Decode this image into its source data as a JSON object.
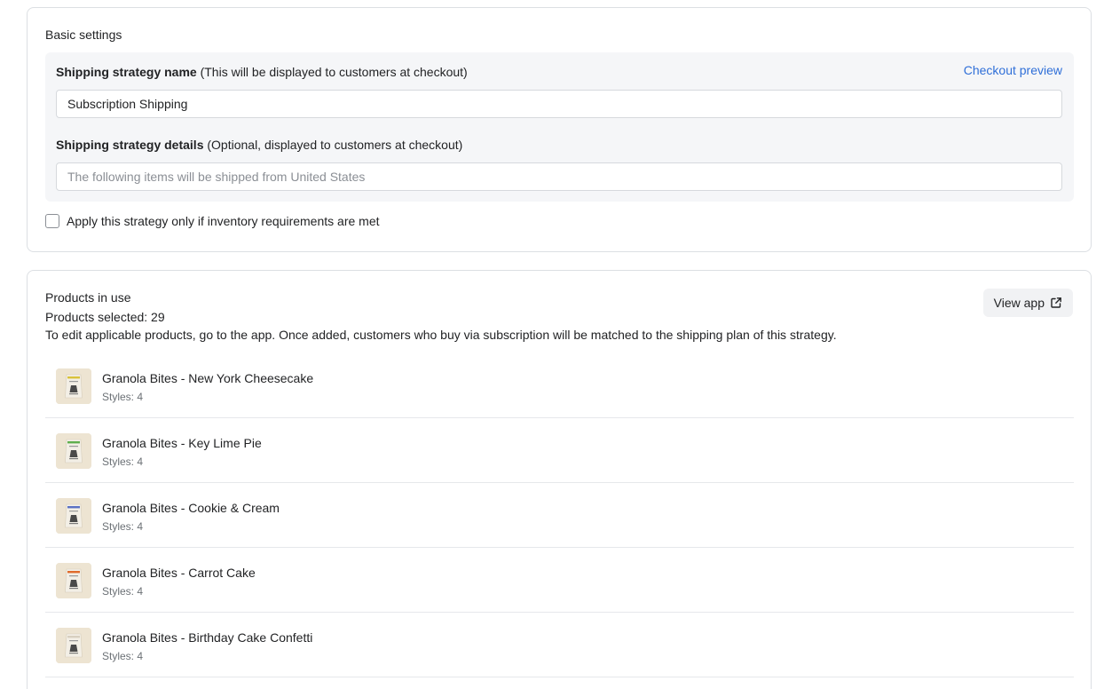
{
  "basic_settings": {
    "title": "Basic settings",
    "name_label_bold": "Shipping strategy name",
    "name_label_note": " (This will be displayed to customers at checkout)",
    "checkout_preview": "Checkout preview",
    "name_value": "Subscription Shipping",
    "details_label_bold": "Shipping strategy details",
    "details_label_note": " (Optional, displayed to customers at checkout)",
    "details_placeholder": "The following items will be shipped from United States",
    "inventory_checkbox_label": "Apply this strategy only if inventory requirements are met",
    "inventory_checkbox_checked": false
  },
  "products_in_use": {
    "title": "Products in use",
    "selected_count": "Products selected: 29",
    "description": "To edit applicable products, go to the app. Once added, customers who buy via subscription will be matched to the shipping plan of this strategy.",
    "view_app_label": "View app",
    "view_app_icon": "external-link-icon",
    "items": [
      {
        "name": "Granola Bites - New York Cheesecake",
        "styles": "Styles: 4",
        "accent": "#d9c23a"
      },
      {
        "name": "Granola Bites - Key Lime Pie",
        "styles": "Styles: 4",
        "accent": "#5fae4e"
      },
      {
        "name": "Granola Bites - Cookie & Cream",
        "styles": "Styles: 4",
        "accent": "#5b72c4"
      },
      {
        "name": "Granola Bites - Carrot Cake",
        "styles": "Styles: 4",
        "accent": "#e06a2b"
      },
      {
        "name": "Granola Bites - Birthday Cake Confetti",
        "styles": "Styles: 4",
        "accent": "#d8cfc0"
      }
    ]
  },
  "colors": {
    "link": "#2f6fd8",
    "border": "#dcdfe3",
    "panel": "#f5f6f8",
    "thumb_bg": "#ede4d2"
  }
}
